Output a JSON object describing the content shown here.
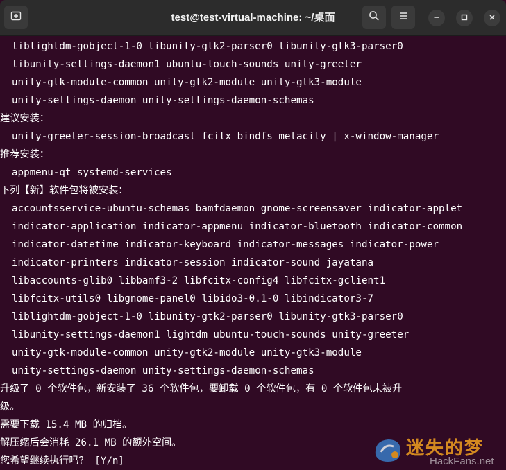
{
  "window": {
    "title": "test@test-virtual-machine: ~/桌面"
  },
  "icons": {
    "new_tab": "new-tab-icon",
    "search": "search-icon",
    "menu": "hamburger-menu-icon",
    "minimize": "minimize-icon",
    "maximize": "maximize-icon",
    "close": "close-icon"
  },
  "colors": {
    "terminal_bg": "#300a24",
    "titlebar_bg": "#2c2c2c",
    "text": "#ffffff"
  },
  "terminal": {
    "lines": [
      {
        "text": "liblightdm-gobject-1-0 libunity-gtk2-parser0 libunity-gtk3-parser0",
        "indent": true
      },
      {
        "text": "libunity-settings-daemon1 ubuntu-touch-sounds unity-greeter",
        "indent": true
      },
      {
        "text": "unity-gtk-module-common unity-gtk2-module unity-gtk3-module",
        "indent": true
      },
      {
        "text": "unity-settings-daemon unity-settings-daemon-schemas",
        "indent": true
      },
      {
        "text": "建议安装：",
        "indent": false
      },
      {
        "text": "unity-greeter-session-broadcast fcitx bindfs metacity | x-window-manager",
        "indent": true
      },
      {
        "text": "推荐安装：",
        "indent": false
      },
      {
        "text": "appmenu-qt systemd-services",
        "indent": true
      },
      {
        "text": "下列【新】软件包将被安装：",
        "indent": false
      },
      {
        "text": "accountsservice-ubuntu-schemas bamfdaemon gnome-screensaver indicator-applet",
        "indent": true
      },
      {
        "text": "indicator-application indicator-appmenu indicator-bluetooth indicator-common",
        "indent": true
      },
      {
        "text": "indicator-datetime indicator-keyboard indicator-messages indicator-power",
        "indent": true
      },
      {
        "text": "indicator-printers indicator-session indicator-sound jayatana",
        "indent": true
      },
      {
        "text": "libaccounts-glib0 libbamf3-2 libfcitx-config4 libfcitx-gclient1",
        "indent": true
      },
      {
        "text": "libfcitx-utils0 libgnome-panel0 libido3-0.1-0 libindicator3-7",
        "indent": true
      },
      {
        "text": "liblightdm-gobject-1-0 libunity-gtk2-parser0 libunity-gtk3-parser0",
        "indent": true
      },
      {
        "text": "libunity-settings-daemon1 lightdm ubuntu-touch-sounds unity-greeter",
        "indent": true
      },
      {
        "text": "unity-gtk-module-common unity-gtk2-module unity-gtk3-module",
        "indent": true
      },
      {
        "text": "unity-settings-daemon unity-settings-daemon-schemas",
        "indent": true
      },
      {
        "text": "升级了 0 个软件包，新安装了 36 个软件包，要卸载 0 个软件包，有 0 个软件包未被升",
        "indent": false
      },
      {
        "text": "级。",
        "indent": false
      },
      {
        "text": "需要下载 15.4 MB 的归档。",
        "indent": false
      },
      {
        "text": "解压缩后会消耗 26.1 MB 的额外空间。",
        "indent": false
      },
      {
        "text": "您希望继续执行吗？ [Y/n]",
        "indent": false
      }
    ]
  },
  "watermark": {
    "text": "迷失的梦",
    "sub": "HackFans.net"
  }
}
